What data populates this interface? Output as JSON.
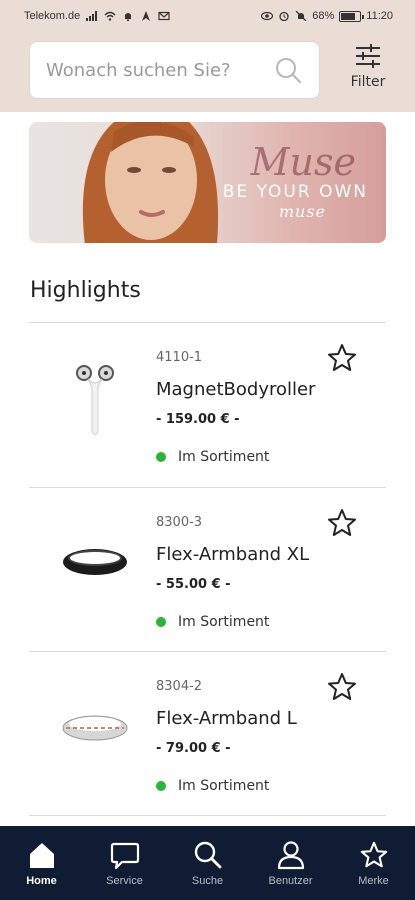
{
  "status_bar": {
    "carrier": "Telekom.de",
    "battery": "68%",
    "time": "11:20"
  },
  "search": {
    "placeholder": "Wonach suchen Sie?"
  },
  "filter": {
    "label": "Filter"
  },
  "banner": {
    "script_text": "Muse",
    "title": "BE YOUR OWN",
    "subtitle": "muse"
  },
  "highlights": {
    "title": "Highlights",
    "products": [
      {
        "code": "4110-1",
        "name": "MagnetBodyroller",
        "price": "- 159.00 € -",
        "status": "Im Sortiment",
        "image": "bodyroller-image"
      },
      {
        "code": "8300-3",
        "name": "Flex-Armband XL",
        "price": "- 55.00 € -",
        "status": "Im Sortiment",
        "image": "black-bracelet-image"
      },
      {
        "code": "8304-2",
        "name": "Flex-Armband L",
        "price": "- 79.00 € -",
        "status": "Im Sortiment",
        "image": "silver-bracelet-image"
      }
    ]
  },
  "nav": {
    "items": [
      {
        "label": "Home",
        "icon": "home-icon"
      },
      {
        "label": "Service",
        "icon": "chat-icon"
      },
      {
        "label": "Suche",
        "icon": "search-icon"
      },
      {
        "label": "Benutzer",
        "icon": "user-icon"
      },
      {
        "label": "Merke",
        "icon": "star-icon"
      }
    ]
  },
  "colors": {
    "header_bg": "#eaddd5",
    "nav_bg": "#0f1c33",
    "status_green": "#2bb43a"
  }
}
